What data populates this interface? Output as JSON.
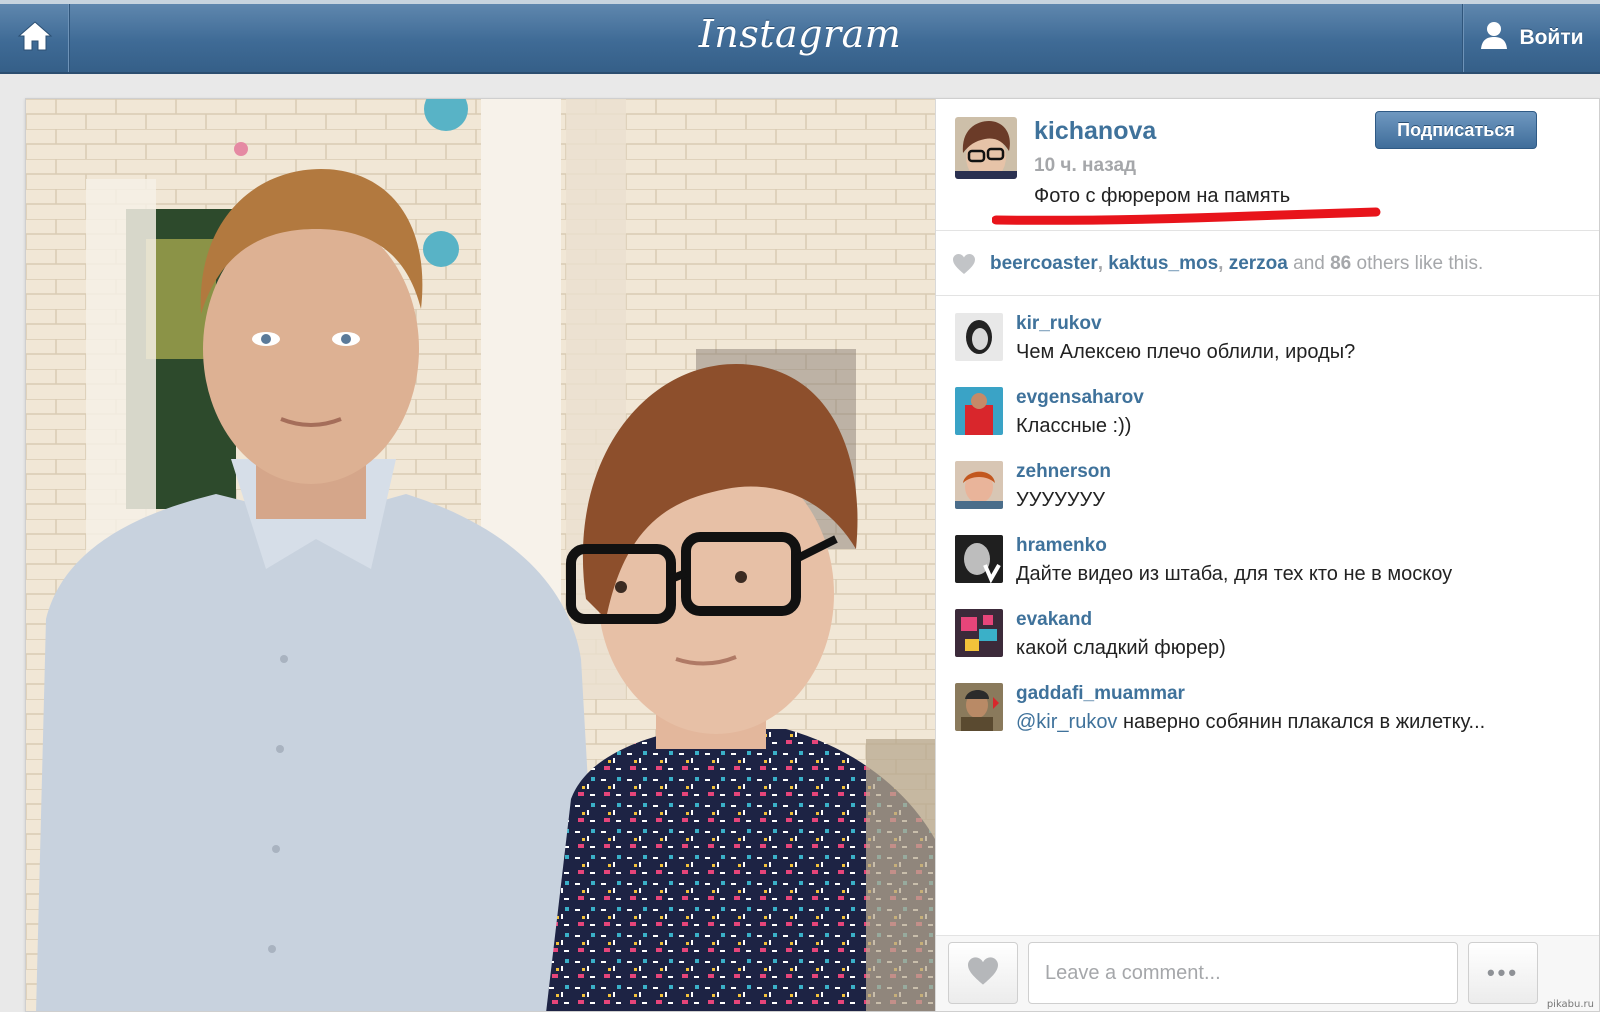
{
  "header": {
    "logo": "Instagram",
    "home_icon": "home-icon",
    "login_icon": "user-icon",
    "login_label": "Войти"
  },
  "post": {
    "photo_description": "photo",
    "owner": {
      "username": "kichanova",
      "time": "10 ч. назад",
      "caption": "Фото с фюрером на память",
      "follow_label": "Подписаться"
    },
    "likes": {
      "users": [
        "beercoaster",
        "kaktus_mos",
        "zerzoa"
      ],
      "and_text": "and",
      "count": "86",
      "suffix": "others like this."
    },
    "comments": [
      {
        "user": "kir_rukov",
        "text": "Чем Алексею плечо облили, ироды?"
      },
      {
        "user": "evgensaharov",
        "text": "Классные :))"
      },
      {
        "user": "zehnerson",
        "text": "УУУУУУУ"
      },
      {
        "user": "hramenko",
        "text": "Дайте видео из штаба, для тех кто не в москоу"
      },
      {
        "user": "evakand",
        "text": "какой сладкий фюрер)"
      },
      {
        "user": "gaddafi_muammar",
        "mention": "@kir_rukov",
        "text": "наверно собянин плакался в жилетку..."
      }
    ],
    "comment_placeholder": "Leave a comment...",
    "more_label": "•••"
  },
  "watermark": "pikabu.ru",
  "colors": {
    "link": "#3f729b",
    "topbar": "#3f6b96",
    "annotation": "#e8141b"
  }
}
